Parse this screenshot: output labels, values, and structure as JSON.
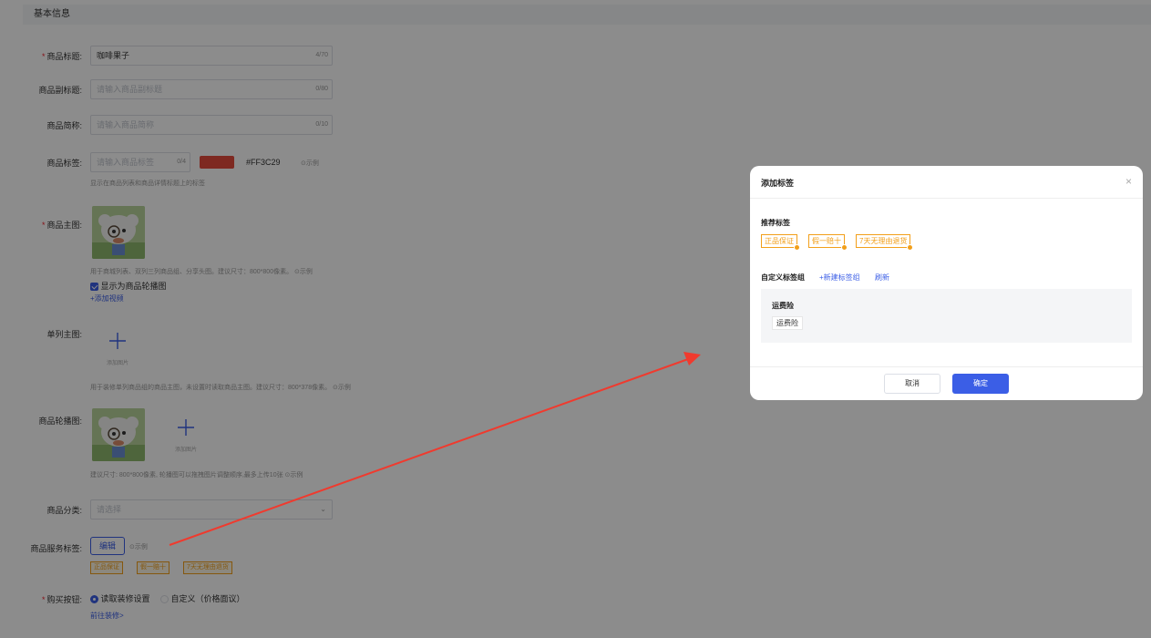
{
  "section": {
    "title": "基本信息"
  },
  "form": {
    "title": {
      "label": "商品标题:",
      "value": "咖啡果子",
      "count": "4/70"
    },
    "subtitle": {
      "label": "商品副标题:",
      "placeholder": "请输入商品副标题",
      "count": "0/80"
    },
    "short_name": {
      "label": "商品简称:",
      "placeholder": "请输入商品简称",
      "count": "0/10"
    },
    "product_tag": {
      "label": "商品标签:",
      "placeholder": "请输入商品标签",
      "count": "0/4",
      "color_hex": "#FF3C29",
      "color_swatch": "#e64c3c",
      "example": "⊙示例",
      "hint": "显示在商品列表和商品详情标题上的标签"
    },
    "main_image": {
      "label": "商品主图:",
      "hint": "用于商城列表、双列三列商品组、分享头图。建议尺寸：800*800像素。",
      "example": "⊙示例",
      "checkbox_label": "显示为商品轮播图",
      "add_video": "+添加视频"
    },
    "single_image": {
      "label": "单列主图:",
      "upload_text": "添加图片",
      "hint": "用于装修单列商品组的商品主图，未设置时读取商品主图。建议尺寸：800*378像素。",
      "example": "⊙示例"
    },
    "carousel": {
      "label": "商品轮播图:",
      "upload_text": "添加图片",
      "hint": "建议尺寸: 800*800像素, 轮播图可以拖拽图片调整顺序,最多上传10张",
      "example": "⊙示例"
    },
    "category": {
      "label": "商品分类:",
      "placeholder": "请选择"
    },
    "service_tags": {
      "label": "商品服务标签:",
      "edit_button": "编辑",
      "example": "⊙示例",
      "tags": [
        "正品保证",
        "假一赔十",
        "7天无理由退货"
      ]
    },
    "buy_button": {
      "label": "购买按钮:",
      "option1": "读取装修设置",
      "option2": "自定义（价格面议）",
      "link": "前往装修>"
    }
  },
  "dialog": {
    "title": "添加标签",
    "close": "×",
    "recommended_title": "推荐标签",
    "recommended_tags": [
      "正品保证",
      "假一赔十",
      "7天无理由退货"
    ],
    "custom_group_title": "自定义标签组",
    "new_group_link": "+新建标签组",
    "refresh_link": "刷新",
    "group": {
      "name": "运费险",
      "tags": [
        "运费险"
      ]
    },
    "cancel": "取消",
    "confirm": "确定"
  },
  "colors": {
    "accent": "#3b5ee6",
    "tag_orange": "#f29f1a",
    "arrow_red": "#f03a2e"
  }
}
